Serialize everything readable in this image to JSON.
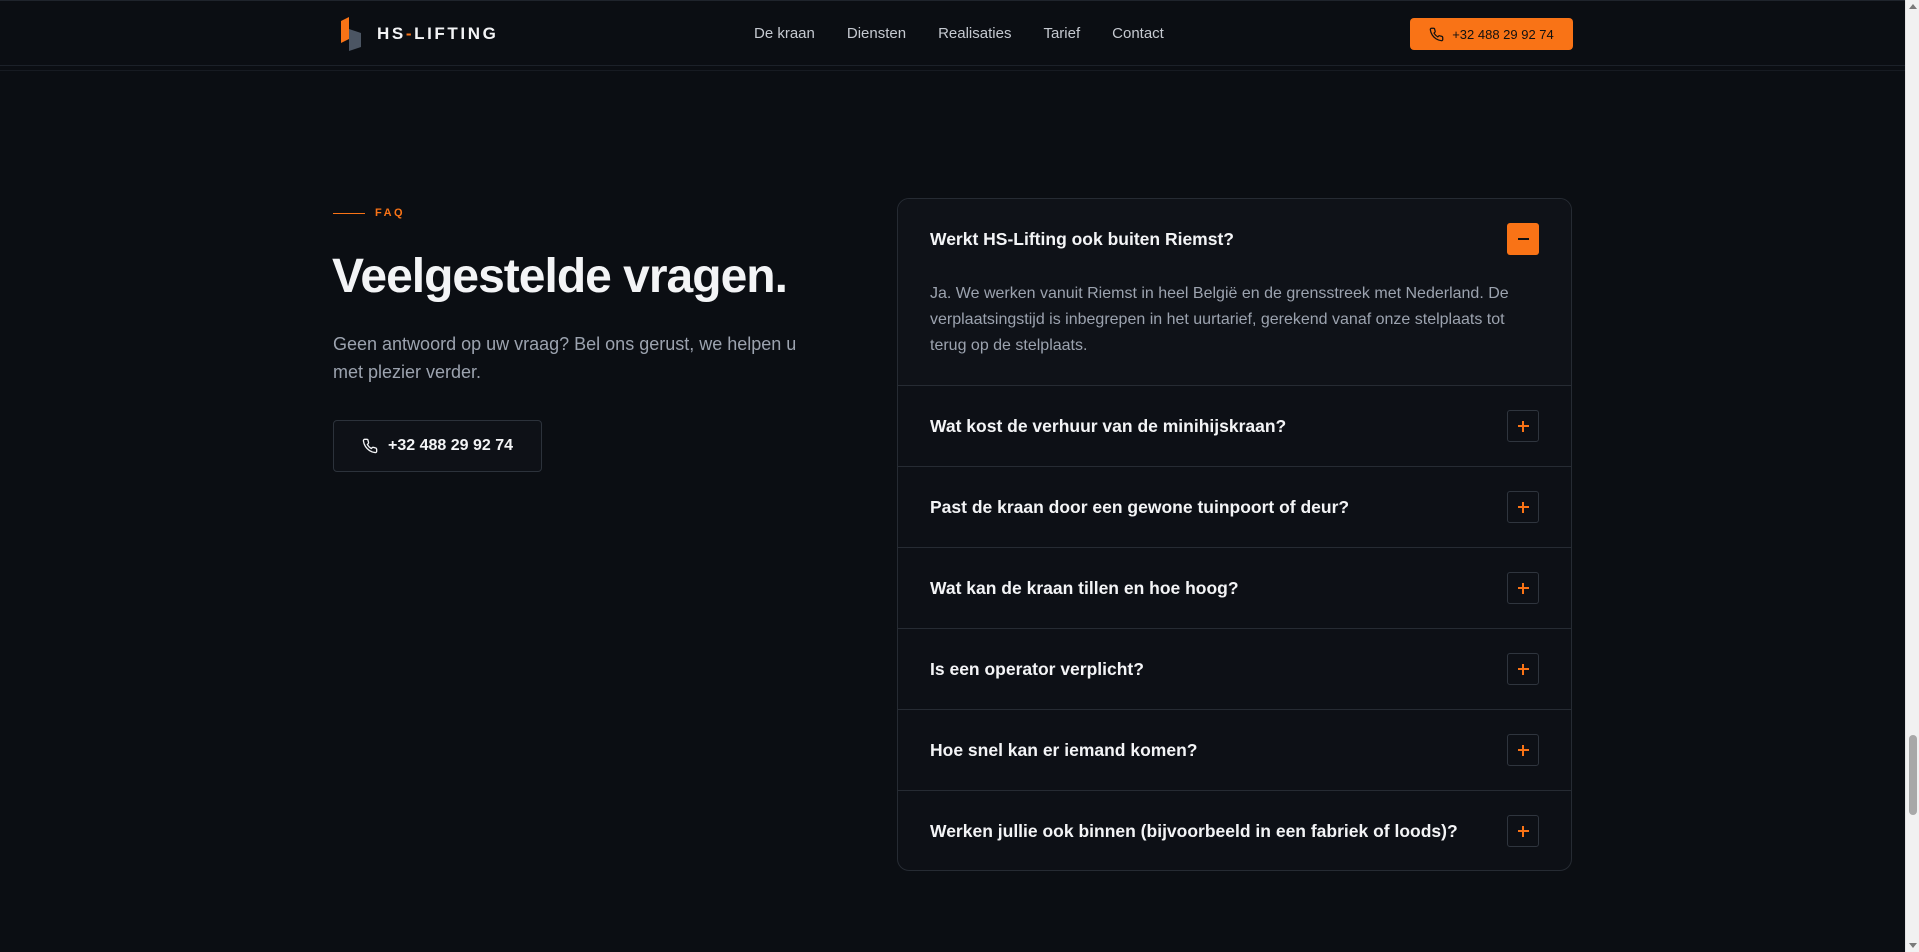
{
  "header": {
    "logo_text_left": "HS",
    "logo_text_dash": "-",
    "logo_text_right": "LIFTING",
    "nav": [
      "De kraan",
      "Diensten",
      "Realisaties",
      "Tarief",
      "Contact"
    ],
    "cta_phone": "+32 488 29 92 74"
  },
  "intro": {
    "eyebrow": "FAQ",
    "title": "Veelgestelde vragen.",
    "subtitle": "Geen antwoord op uw vraag? Bel ons gerust, we helpen u met plezier verder.",
    "cta_phone": "+32 488 29 92 74"
  },
  "faq": {
    "items": [
      {
        "question": "Werkt HS-Lifting ook buiten Riemst?",
        "answer": "Ja. We werken vanuit Riemst in heel België en de grensstreek met Nederland. De verplaatsingstijd is inbegrepen in het uurtarief, gerekend vanaf onze stelplaats tot terug op de stelplaats.",
        "expanded": true
      },
      {
        "question": "Wat kost de verhuur van de minihijskraan?",
        "expanded": false
      },
      {
        "question": "Past de kraan door een gewone tuinpoort of deur?",
        "expanded": false
      },
      {
        "question": "Wat kan de kraan tillen en hoe hoog?",
        "expanded": false
      },
      {
        "question": "Is een operator verplicht?",
        "expanded": false
      },
      {
        "question": "Hoe snel kan er iemand komen?",
        "expanded": false
      },
      {
        "question": "Werken jullie ook binnen (bijvoorbeeld in een fabriek of loods)?",
        "expanded": false
      }
    ]
  },
  "colors": {
    "accent": "#f97316",
    "background": "#0b0e13",
    "text": "#f3f4f6",
    "muted": "#9ca3af"
  },
  "icons": {
    "phone": "phone-icon",
    "collapse": "minus-icon",
    "expand": "plus-icon"
  }
}
